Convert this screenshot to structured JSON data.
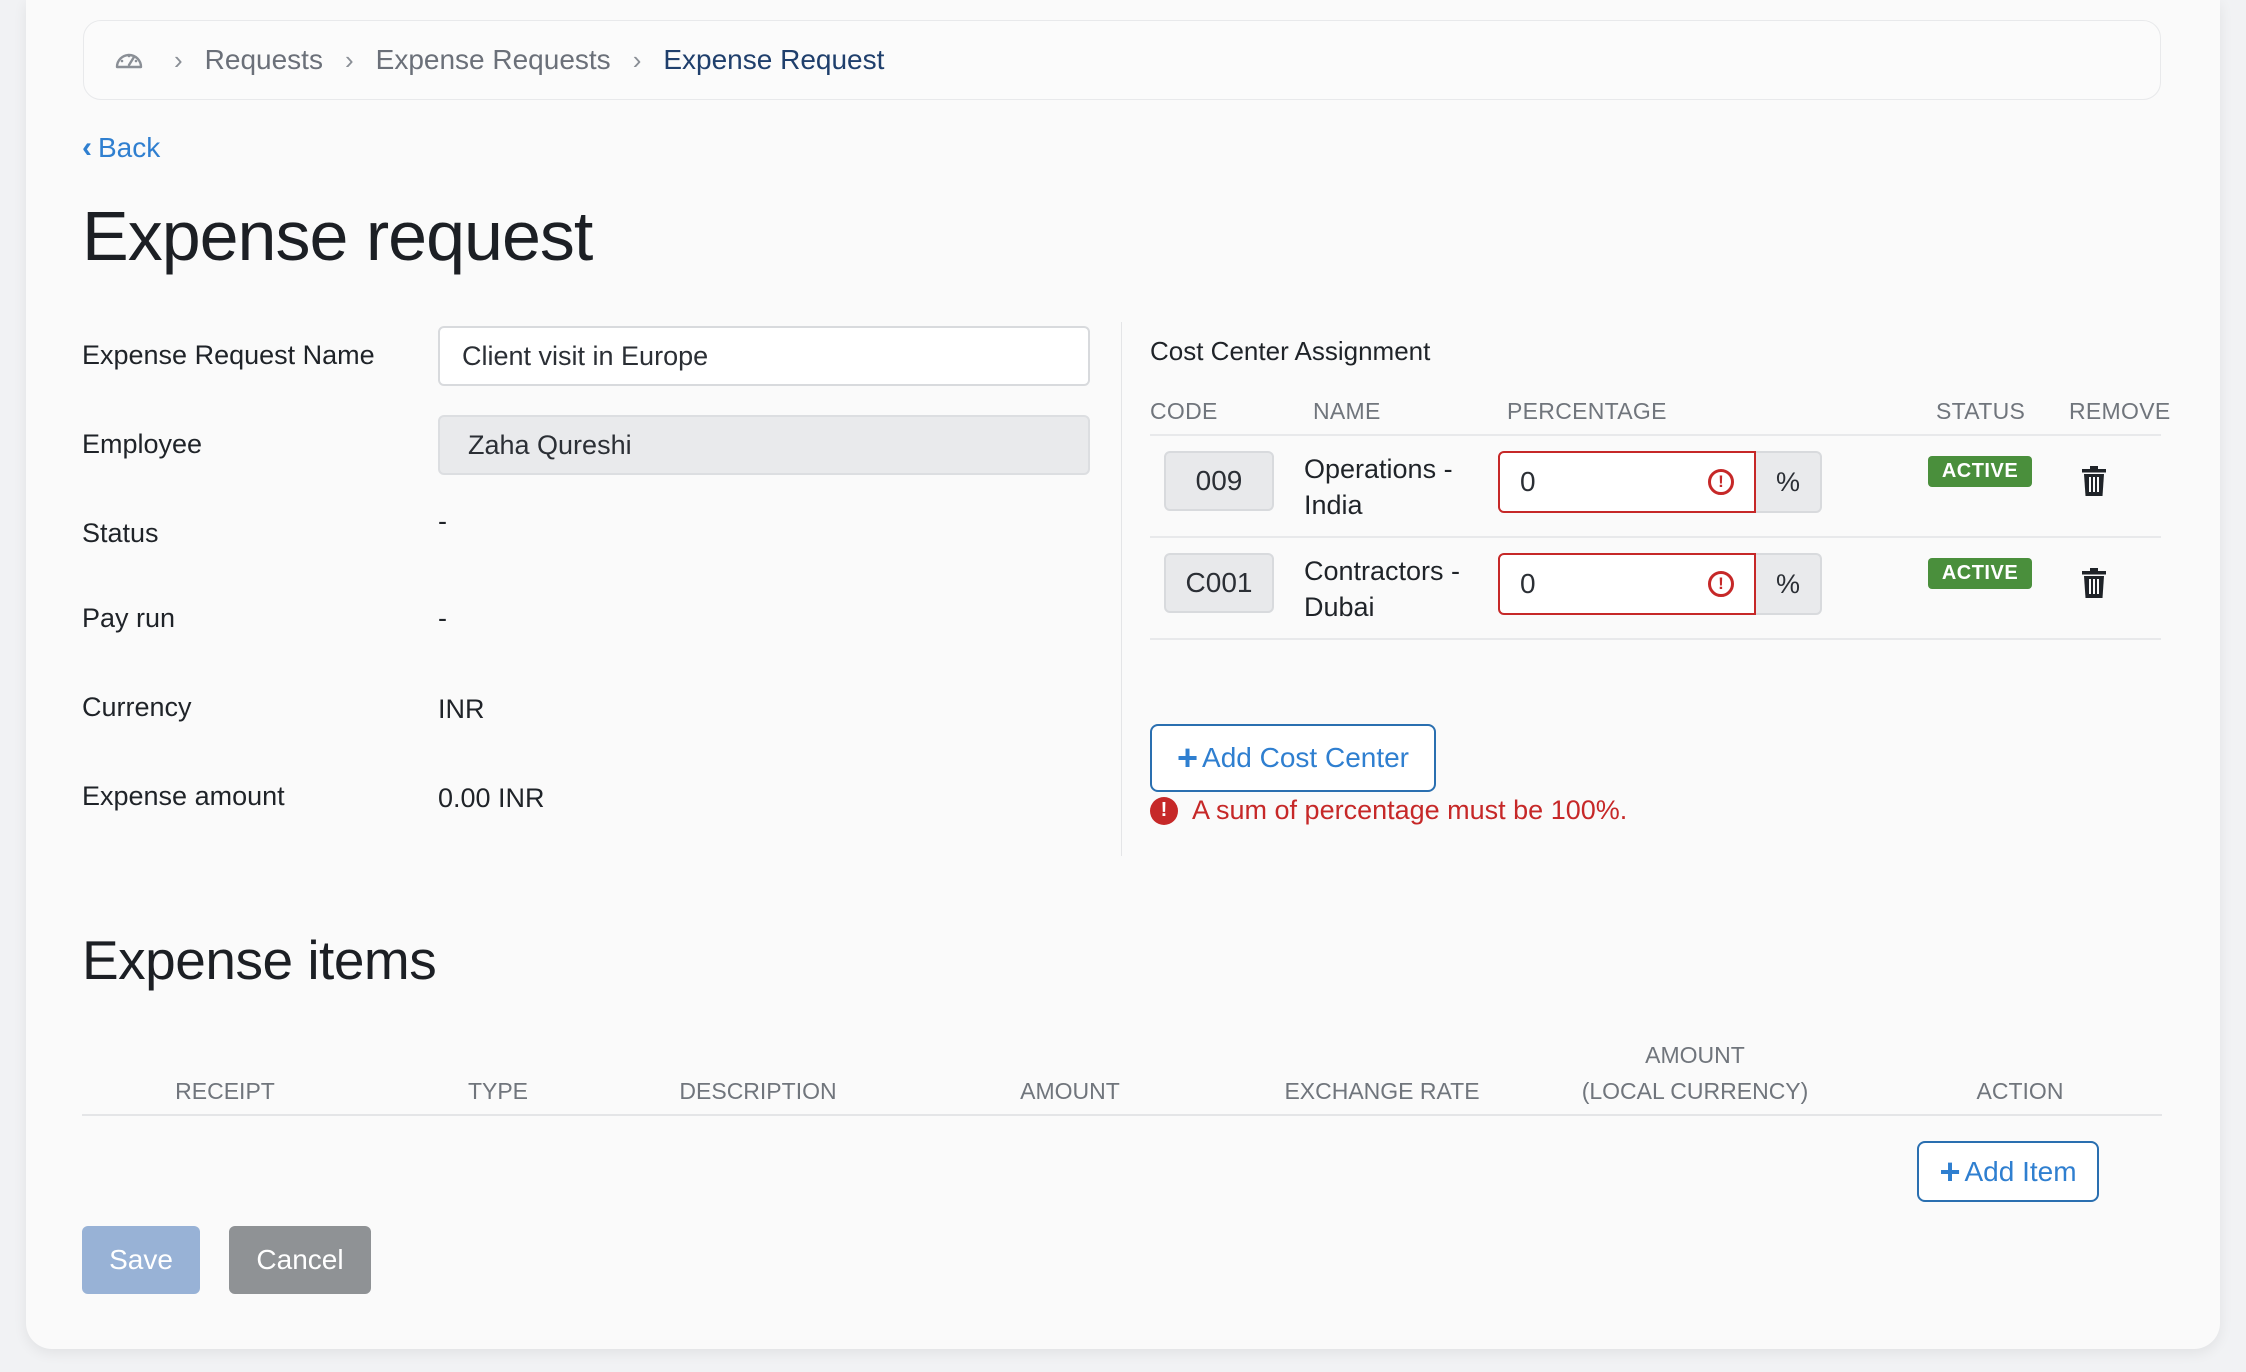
{
  "breadcrumb": {
    "home_icon": "dashboard-icon",
    "items": [
      "Requests",
      "Expense Requests",
      "Expense Request"
    ]
  },
  "back_label": "Back",
  "page_title": "Expense request",
  "form": {
    "name_label": "Expense Request Name",
    "name_value": "Client visit in Europe",
    "employee_label": "Employee",
    "employee_value": "Zaha Qureshi",
    "status_label": "Status",
    "status_value": "-",
    "payrun_label": "Pay run",
    "payrun_value": "-",
    "currency_label": "Currency",
    "currency_value": "INR",
    "amount_label": "Expense amount",
    "amount_value": "0.00 INR"
  },
  "cost_center": {
    "title": "Cost Center Assignment",
    "headers": {
      "code": "CODE",
      "name": "NAME",
      "percentage": "PERCENTAGE",
      "status": "STATUS",
      "remove": "REMOVE"
    },
    "rows": [
      {
        "code": "009",
        "name": "Operations - India",
        "percentage": "0",
        "unit": "%",
        "status": "ACTIVE"
      },
      {
        "code": "C001",
        "name": "Contractors - Dubai",
        "percentage": "0",
        "unit": "%",
        "status": "ACTIVE"
      }
    ],
    "add_label": "Add Cost Center",
    "error": "A sum of percentage must be 100%.",
    "error_color": "#c62828",
    "active_color": "#4a8f3c"
  },
  "expense_items": {
    "title": "Expense items",
    "headers": [
      "RECEIPT",
      "TYPE",
      "DESCRIPTION",
      "AMOUNT",
      "EXCHANGE RATE",
      "AMOUNT",
      "(LOCAL CURRENCY)",
      "ACTION"
    ],
    "add_label": "Add Item"
  },
  "actions": {
    "save_label": "Save",
    "cancel_label": "Cancel"
  }
}
